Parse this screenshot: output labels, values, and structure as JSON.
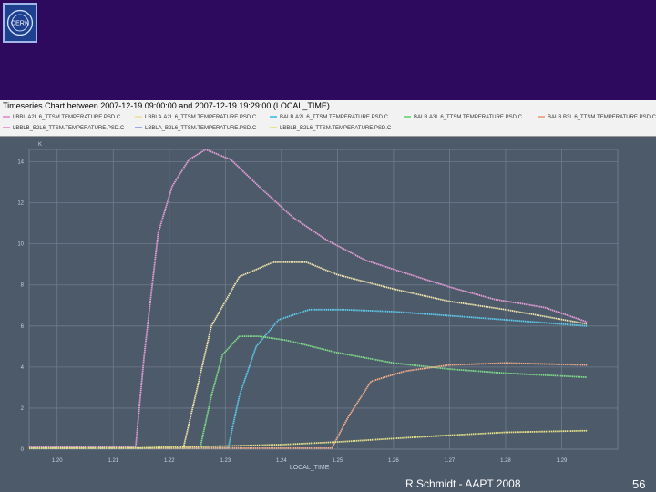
{
  "title": "Timeseries Chart between 2007-12-19 09:00:00 and 2007-12-19 19:29:00 (LOCAL_TIME)",
  "footer": "R.Schmidt - AAPT 2008",
  "page_number": "56",
  "chart_data": {
    "type": "line",
    "xlabel": "LOCAL_TIME",
    "ylabel": "K",
    "xlim": [
      1.195,
      1.3
    ],
    "ylim": [
      0,
      14.6
    ],
    "x_ticks": [
      "1.20",
      "1.21",
      "1.22",
      "1.23",
      "1.24",
      "1.25",
      "1.26",
      "1.27",
      "1.28",
      "1.29"
    ],
    "y_ticks": [
      0,
      2,
      4,
      6,
      8,
      10,
      12,
      14
    ],
    "grid": true,
    "legend_position": "top",
    "series": [
      {
        "name": "LBBL.A2L.6_TTSM.TEMPERATURE.PSD.C",
        "color": "#e39ed6",
        "x": [
          1.195,
          1.214,
          1.2155,
          1.218,
          1.2205,
          1.2235,
          1.2265,
          1.231,
          1.236,
          1.242,
          1.248,
          1.255,
          1.263,
          1.27,
          1.278,
          1.287,
          1.2945
        ],
        "y": [
          0.1,
          0.1,
          4.5,
          10.5,
          12.8,
          14.1,
          14.6,
          14.1,
          12.8,
          11.3,
          10.2,
          9.2,
          8.5,
          7.9,
          7.3,
          6.9,
          6.2
        ]
      },
      {
        "name": "LBBLA.A2L.6_TTSM.TEMPERATURE.PSD.C",
        "color": "#eee3ad",
        "x": [
          1.195,
          1.2225,
          1.2245,
          1.2275,
          1.2325,
          1.2385,
          1.2445,
          1.25,
          1.26,
          1.27,
          1.28,
          1.2945
        ],
        "y": [
          0.05,
          0.05,
          2.4,
          6.0,
          8.4,
          9.1,
          9.1,
          8.5,
          7.8,
          7.2,
          6.8,
          6.1
        ]
      },
      {
        "name": "BALB.A2L.6_TTSM.TEMPERATURE.PSD.C",
        "color": "#5fc8e8",
        "x": [
          1.195,
          1.2305,
          1.2325,
          1.2355,
          1.2395,
          1.245,
          1.251,
          1.26,
          1.27,
          1.28,
          1.2945
        ],
        "y": [
          0.05,
          0.05,
          2.6,
          5.0,
          6.3,
          6.8,
          6.8,
          6.7,
          6.5,
          6.3,
          6.0
        ]
      },
      {
        "name": "BALB.A3L.6_TTSM.TEMPERATURE.PSD.C",
        "color": "#7fd98a",
        "x": [
          1.195,
          1.2255,
          1.2275,
          1.2295,
          1.2325,
          1.236,
          1.241,
          1.25,
          1.26,
          1.27,
          1.28,
          1.2945
        ],
        "y": [
          0.05,
          0.05,
          2.6,
          4.6,
          5.5,
          5.5,
          5.3,
          4.7,
          4.2,
          3.9,
          3.7,
          3.5
        ]
      },
      {
        "name": "BALB.A3L.6_TTSM.TEMPERATURE.PSD.C",
        "color": "#f0ac8a",
        "x": [
          1.195,
          1.249,
          1.252,
          1.256,
          1.262,
          1.27,
          1.28,
          1.2945
        ],
        "y": [
          0.05,
          0.05,
          1.6,
          3.3,
          3.8,
          4.1,
          4.2,
          4.1
        ]
      },
      {
        "name": "LBBLA.B2L.6_TTSM.TEMPERATURE.PSD.C",
        "color": "#e6e28a",
        "x": [
          1.195,
          1.215,
          1.22,
          1.23,
          1.24,
          1.25,
          1.26,
          1.27,
          1.28,
          1.2945
        ],
        "y": [
          0.05,
          0.06,
          0.1,
          0.15,
          0.22,
          0.35,
          0.52,
          0.68,
          0.82,
          0.9
        ]
      }
    ],
    "legend_entries": [
      "LBBL.A2L.6_TTSM.TEMPERATURE.PSD.C",
      "LBBLA.A2L.6_TTSM.TEMPERATURE.PSD.C",
      "BALB.A2L.6_TTSM.TEMPERATURE.PSD.C",
      "BALB.A3L.6_TTSM.TEMPERATURE.PSD.C",
      "BALB.B3L.6_TTSM.TEMPERATURE.PSD.C",
      "LBBLB_B2L6_TTSM.TEMPERATURE.PSD.C",
      "LBBLA_B2L6_TTSM.TEMPERATURE.PSD.C",
      "LBBLB_B2L6_TTSM.TEMPERATURE.PSD.C"
    ],
    "legend_colors": [
      "#e39ed6",
      "#eee3ad",
      "#5fc8e8",
      "#7fd98a",
      "#f0ac8a",
      "#e39ed6",
      "#9aa7e8",
      "#e6e28a"
    ]
  }
}
